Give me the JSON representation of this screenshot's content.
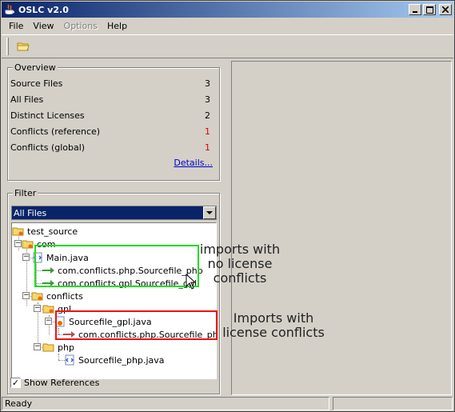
{
  "window": {
    "title": "OSLC v2.0"
  },
  "menu": {
    "file": "File",
    "view": "View",
    "options": "Options",
    "help": "Help"
  },
  "toolbar": {
    "open_icon": "folder-icon"
  },
  "overview": {
    "legend": "Overview",
    "rows": [
      {
        "label": "Source Files",
        "value": "3"
      },
      {
        "label": "All Files",
        "value": "3"
      },
      {
        "label": "Distinct Licenses",
        "value": "2"
      },
      {
        "label": "Conflicts (reference)",
        "value": "1"
      },
      {
        "label": "Conflicts (global)",
        "value": "1"
      }
    ],
    "details_link": "Details..."
  },
  "filter": {
    "legend": "Filter",
    "selected": "All Files"
  },
  "tree": {
    "root": "test_source",
    "com": "com",
    "main_java": "Main.java",
    "import_php": "com.conflicts.php.Sourcefile_php",
    "import_gpl": "com.conflicts.gpl.Sourcefile_gpl",
    "conflicts": "conflicts",
    "gpl": "gpl",
    "sourcefile_gpl": "Sourcefile_gpl.java",
    "import_php_conflict": "com.conflicts.php.Sourcefile_php",
    "php": "php",
    "sourcefile_php": "Sourcefile_php.java"
  },
  "show_references": {
    "label": "Show References",
    "checked": true
  },
  "status": {
    "text": "Ready"
  },
  "annotations": {
    "green_line1": "imports with",
    "green_line2": "no license",
    "green_line3": "conflicts",
    "red_line1": "Imports with",
    "red_line2": "license conflicts"
  },
  "colors": {
    "conflict_red": "#e00000",
    "no_conflict_box": "#22dd22",
    "conflict_box": "#ee1111",
    "selection_blue": "#0a246a"
  }
}
